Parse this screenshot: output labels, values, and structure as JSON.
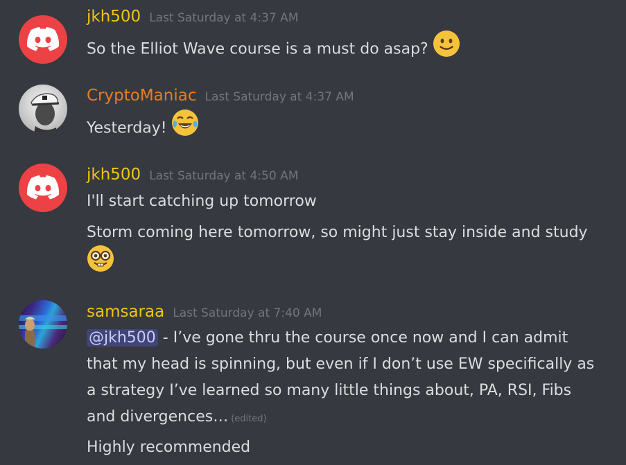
{
  "colors": {
    "background": "#36393f",
    "text": "#dcddde",
    "timestamp": "#72767d",
    "discord_red": "#ed4245",
    "username_gold": "#f1c40f",
    "username_orange": "#e67e22",
    "mention_bg": "#3c4270",
    "mention_text": "#c9cdfb"
  },
  "messages": [
    {
      "username": "jkh500",
      "username_color": "#f1c40f",
      "avatar": "discord-logo-icon",
      "timestamp": "Last Saturday at 4:37 AM",
      "lines": [
        "So the Elliot Wave course is a must do asap?"
      ],
      "emoji": "slightly-smiling-face-icon"
    },
    {
      "username": "CryptoManiac",
      "username_color": "#e67e22",
      "avatar": "user-photo-avatar",
      "timestamp": "Last Saturday at 4:37 AM",
      "lines": [
        "Yesterday!"
      ],
      "emoji": "joy-face-icon"
    },
    {
      "username": "jkh500",
      "username_color": "#f1c40f",
      "avatar": "discord-logo-icon",
      "timestamp": "Last Saturday at 4:50 AM",
      "lines": [
        "I'll start catching up tomorrow",
        "Storm coming here tomorrow, so might just stay inside and study"
      ],
      "emoji": "nerd-face-icon"
    },
    {
      "username": "samsaraa",
      "username_color": "#f1c40f",
      "avatar": "user-photo-avatar",
      "timestamp": "Last Saturday at 7:40 AM",
      "mention": "@jkh500",
      "lines": [
        " - I’ve gone thru the course once now and I can admit",
        "that my head is spinning, but even if I don’t use EW specifically as",
        "a strategy I’ve learned so many little  things about, PA, RSI, Fibs",
        "and divergences…",
        "Highly recommended"
      ],
      "edited_label": "(edited)"
    }
  ]
}
